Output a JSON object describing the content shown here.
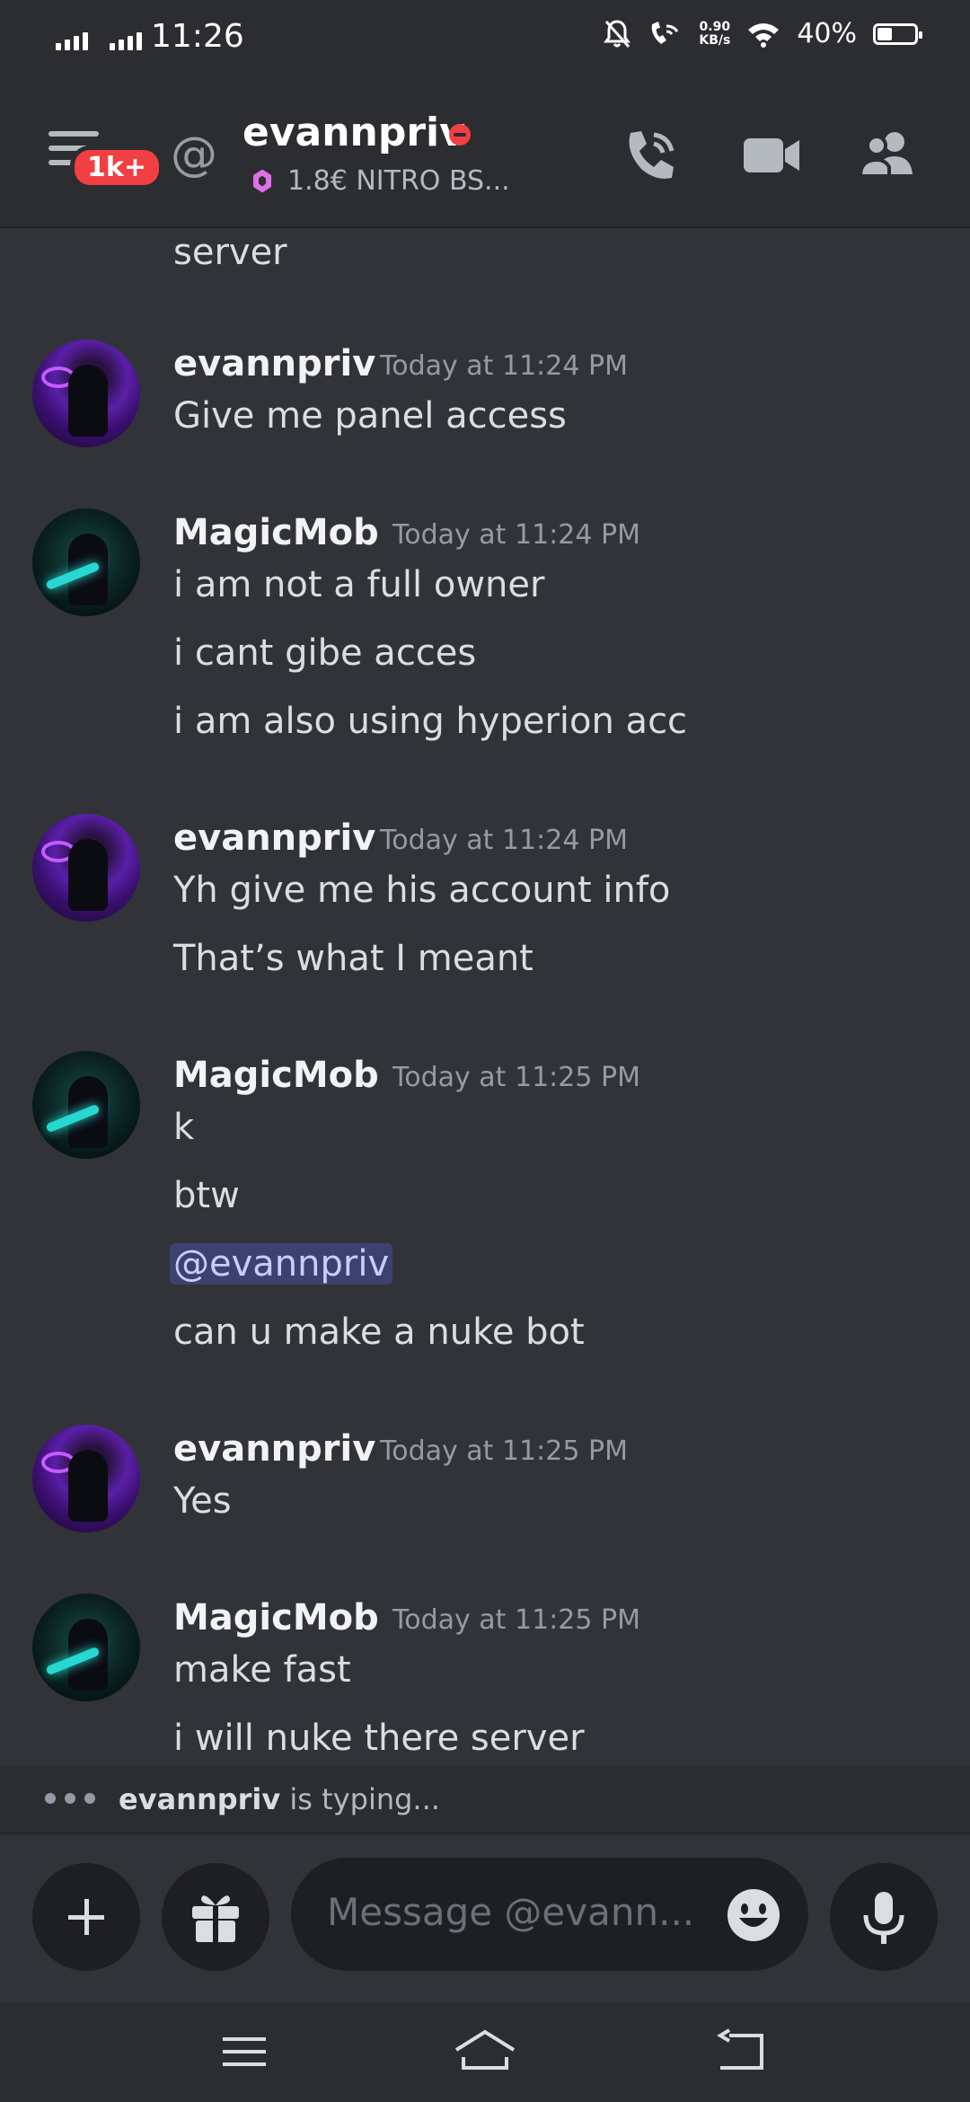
{
  "status_bar": {
    "time": "11:26",
    "net_speed_value": "0.90",
    "net_speed_unit": "KB/s",
    "battery": "40%",
    "battery_level": 0.4,
    "icons": [
      "signal-icon",
      "signal-icon",
      "mute-icon",
      "wifi-calling-icon",
      "wifi-icon",
      "battery-icon"
    ]
  },
  "header": {
    "unread_badge": "1k+",
    "username": "evannpriv",
    "status_text": "1.8€ NITRO BS...",
    "presence": "do-not-disturb",
    "icons": [
      "menu-icon",
      "at-icon",
      "call-icon",
      "video-icon",
      "members-icon"
    ]
  },
  "messages": [
    {
      "continued_text": "server"
    },
    {
      "author": "evannpriv",
      "timestamp": "Today at 11:24 PM",
      "lines": [
        "Give me panel access"
      ]
    },
    {
      "author": "MagicMob",
      "timestamp": "Today at 11:24 PM",
      "lines": [
        "i am not a full owner",
        "i cant gibe acces",
        "i am also using hyperion acc"
      ]
    },
    {
      "author": "evannpriv",
      "timestamp": "Today at 11:24 PM",
      "lines": [
        "Yh give me his account info",
        "That’s what I meant"
      ]
    },
    {
      "author": "MagicMob",
      "timestamp": "Today at 11:25 PM",
      "lines": [
        "k",
        "btw",
        "@evannpriv",
        "can u make a nuke bot"
      ]
    },
    {
      "author": "evannpriv",
      "timestamp": "Today at 11:25 PM",
      "lines": [
        "Yes"
      ]
    },
    {
      "author": "MagicMob",
      "timestamp": "Today at 11:25 PM",
      "lines": [
        "make fast",
        "i will nuke there server"
      ]
    }
  ],
  "typing": {
    "user": "evannpriv",
    "suffix": " is typing..."
  },
  "composer": {
    "placeholder": "Message @evann...",
    "icons": [
      "plus-icon",
      "gift-icon",
      "emoji-icon",
      "microphone-icon"
    ]
  },
  "nav": {
    "icons": [
      "recents-icon",
      "home-icon",
      "back-icon"
    ]
  },
  "colors": {
    "background": "#313338",
    "header": "#2b2d31",
    "dnd": "#f23f43",
    "mention_bg": "#3c4270",
    "nitro": "#e06fe8"
  }
}
